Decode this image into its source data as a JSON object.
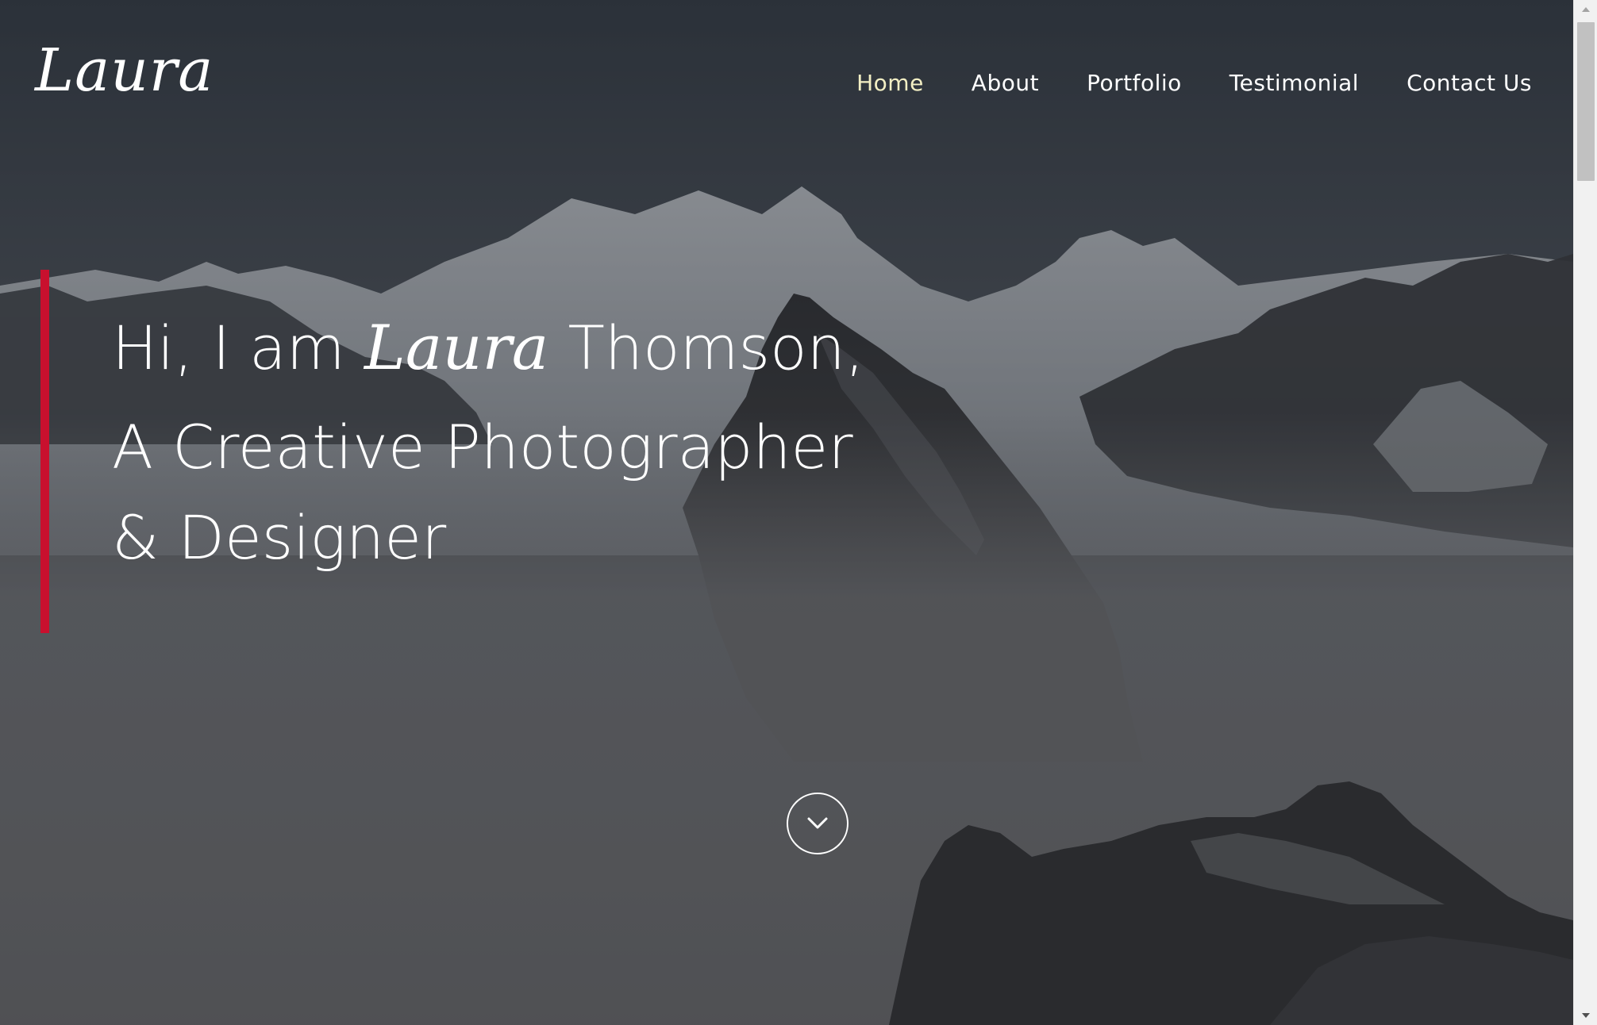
{
  "brand": {
    "logo": "Laura"
  },
  "nav": {
    "items": [
      {
        "label": "Home",
        "active": true
      },
      {
        "label": "About"
      },
      {
        "label": "Portfolio"
      },
      {
        "label": "Testimonial"
      },
      {
        "label": "Contact Us"
      }
    ]
  },
  "hero": {
    "line1_prefix": "Hi, I am",
    "line1_name": "Laura",
    "line1_suffix": "Thomson,",
    "line2": "A Creative Photographer",
    "line3": "& Designer"
  },
  "scroll_button": {
    "icon": "chevron-down-icon"
  },
  "colors": {
    "accent_bar": "#c8102e",
    "active_nav": "#f3efc4",
    "text": "#ffffff"
  }
}
